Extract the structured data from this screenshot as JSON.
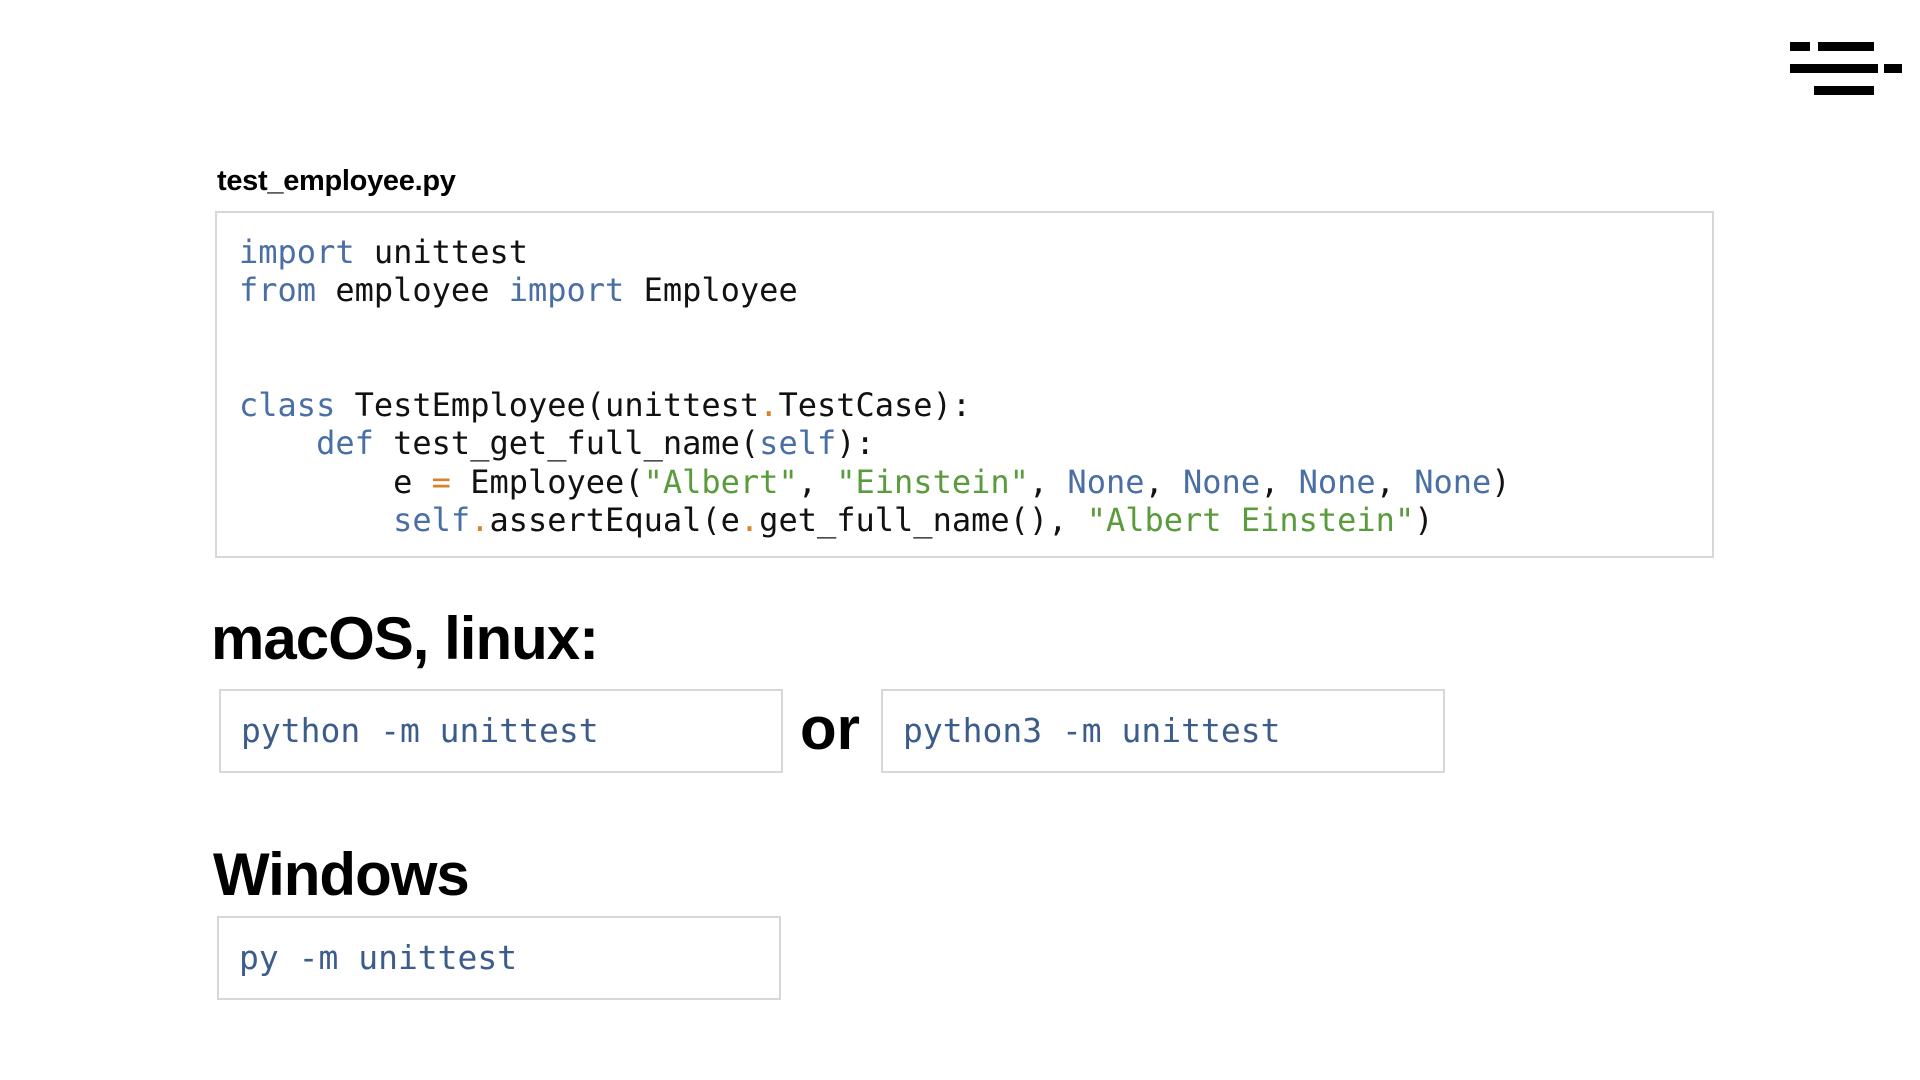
{
  "file_label": "test_employee.py",
  "code_lines": [
    [
      {
        "t": "import",
        "c": "kw"
      },
      {
        "t": " unittest",
        "c": ""
      }
    ],
    [
      {
        "t": "from",
        "c": "kw"
      },
      {
        "t": " employee ",
        "c": ""
      },
      {
        "t": "import",
        "c": "kw"
      },
      {
        "t": " Employee",
        "c": ""
      }
    ],
    [],
    [],
    [
      {
        "t": "class",
        "c": "kw"
      },
      {
        "t": " TestEmployee(unittest",
        "c": ""
      },
      {
        "t": ".",
        "c": "op"
      },
      {
        "t": "TestCase):",
        "c": ""
      }
    ],
    [
      {
        "t": "    ",
        "c": ""
      },
      {
        "t": "def",
        "c": "kw"
      },
      {
        "t": " test_get_full_name(",
        "c": ""
      },
      {
        "t": "self",
        "c": "kw"
      },
      {
        "t": "):",
        "c": ""
      }
    ],
    [
      {
        "t": "        e ",
        "c": ""
      },
      {
        "t": "=",
        "c": "op"
      },
      {
        "t": " Employee(",
        "c": ""
      },
      {
        "t": "\"Albert\"",
        "c": "st"
      },
      {
        "t": ", ",
        "c": ""
      },
      {
        "t": "\"Einstein\"",
        "c": "st"
      },
      {
        "t": ", ",
        "c": ""
      },
      {
        "t": "None",
        "c": "kw"
      },
      {
        "t": ", ",
        "c": ""
      },
      {
        "t": "None",
        "c": "kw"
      },
      {
        "t": ", ",
        "c": ""
      },
      {
        "t": "None",
        "c": "kw"
      },
      {
        "t": ", ",
        "c": ""
      },
      {
        "t": "None",
        "c": "kw"
      },
      {
        "t": ")",
        "c": ""
      }
    ],
    [
      {
        "t": "        ",
        "c": ""
      },
      {
        "t": "self",
        "c": "kw"
      },
      {
        "t": ".",
        "c": "op"
      },
      {
        "t": "assertEqual(e",
        "c": ""
      },
      {
        "t": ".",
        "c": "op"
      },
      {
        "t": "get_full_name(), ",
        "c": ""
      },
      {
        "t": "\"Albert Einstein\"",
        "c": "st"
      },
      {
        "t": ")",
        "c": ""
      }
    ]
  ],
  "macos_heading": "macOS, linux:",
  "or_label": "or",
  "cmd_python": "python -m unittest",
  "cmd_python3": "python3 -m unittest",
  "windows_heading": "Windows",
  "cmd_py": "py -m unittest",
  "colors": {
    "keyword": "#4a6fa5",
    "operator": "#d9822b",
    "string": "#5a9b3c",
    "command": "#3c5d8c",
    "border": "#d7d7d7"
  },
  "icons": {
    "logo": "brand-logo-icon"
  }
}
